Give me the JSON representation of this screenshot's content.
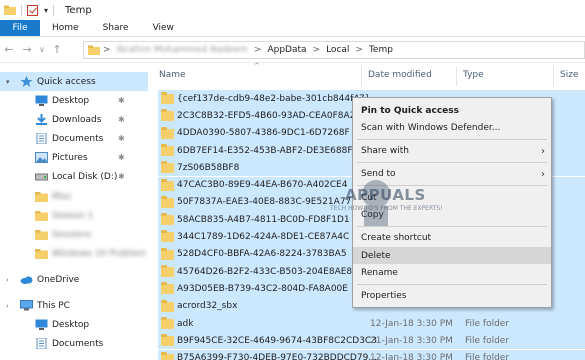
{
  "window": {
    "title": "Temp"
  },
  "ribbon": {
    "tabs": [
      "File",
      "Home",
      "Share",
      "View"
    ]
  },
  "address": {
    "crumbs": [
      "Ibrahim Mohammed Nadeem",
      "AppData",
      "Local",
      "Temp"
    ],
    "separator": ">"
  },
  "navpane": {
    "items": [
      {
        "label": "Quick access",
        "icon": "star-icon",
        "pinned": false,
        "selected": true,
        "blurred": false
      },
      {
        "label": "Desktop",
        "icon": "desktop-icon",
        "pinned": true,
        "selected": false,
        "blurred": false
      },
      {
        "label": "Downloads",
        "icon": "download-icon",
        "pinned": true,
        "selected": false,
        "blurred": false
      },
      {
        "label": "Documents",
        "icon": "documents-icon",
        "pinned": true,
        "selected": false,
        "blurred": false
      },
      {
        "label": "Pictures",
        "icon": "pictures-icon",
        "pinned": true,
        "selected": false,
        "blurred": false
      },
      {
        "label": "Local Disk (D:)",
        "icon": "drive-icon",
        "pinned": true,
        "selected": false,
        "blurred": false
      },
      {
        "label": "Misc",
        "icon": "folder-icon",
        "pinned": false,
        "selected": false,
        "blurred": true
      },
      {
        "label": "Season 1",
        "icon": "folder-icon",
        "pinned": false,
        "selected": false,
        "blurred": true
      },
      {
        "label": "Sessions",
        "icon": "folder-icon",
        "pinned": false,
        "selected": false,
        "blurred": true
      },
      {
        "label": "Windows 10 Problem",
        "icon": "folder-icon",
        "pinned": false,
        "selected": false,
        "blurred": true
      },
      {
        "label": "OneDrive",
        "icon": "cloud-icon",
        "pinned": false,
        "selected": false,
        "blurred": false
      },
      {
        "label": "This PC",
        "icon": "computer-icon",
        "pinned": false,
        "selected": false,
        "blurred": false
      },
      {
        "label": "Desktop",
        "icon": "desktop-icon",
        "pinned": false,
        "selected": false,
        "blurred": false
      },
      {
        "label": "Documents",
        "icon": "documents-icon",
        "pinned": false,
        "selected": false,
        "blurred": false
      }
    ]
  },
  "columns": {
    "name": "Name",
    "date": "Date modified",
    "type": "Type",
    "size": "Size"
  },
  "files": [
    {
      "name": "{cef137de-cdb9-48e2-babe-301cb844f47}",
      "date": "",
      "type": "",
      "selected": true
    },
    {
      "name": "2C3C8B32-EFD5-4B60-93AD-CEA0F8A2",
      "date": "",
      "type": "",
      "selected": true
    },
    {
      "name": "4DDA0390-5807-4386-9DC1-6D7268F",
      "date": "",
      "type": "",
      "selected": true
    },
    {
      "name": "6DB7EF14-E352-453B-ABF2-DE3E688F",
      "date": "",
      "type": "",
      "selected": true
    },
    {
      "name": "7zS06B58BF8",
      "date": "",
      "type": "",
      "selected": true
    },
    {
      "name": "47CAC3B0-89E9-44EA-B670-A402CE4",
      "date": "",
      "type": "",
      "selected": true
    },
    {
      "name": "50F7837A-EAE3-40E8-883C-9E521A77",
      "date": "",
      "type": "",
      "selected": true
    },
    {
      "name": "58ACB835-A4B7-4811-BC0D-FD8F1D1",
      "date": "",
      "type": "",
      "selected": true
    },
    {
      "name": "344C1789-1D62-424A-8DE1-CE87A4C",
      "date": "",
      "type": "",
      "selected": true
    },
    {
      "name": "528D4CF0-BBFA-42A6-8224-3783BA5",
      "date": "",
      "type": "",
      "selected": true
    },
    {
      "name": "45764D26-B2F2-433C-B503-204E8AE8",
      "date": "",
      "type": "",
      "selected": true
    },
    {
      "name": "A93D05EB-B739-43C2-804D-FA8A00E",
      "date": "",
      "type": "",
      "selected": true
    },
    {
      "name": "acrord32_sbx",
      "date": "",
      "type": "",
      "selected": true
    },
    {
      "name": "adk",
      "date": "12-Jan-18 3:30 PM",
      "type": "File folder",
      "selected": true
    },
    {
      "name": "B9F945CE-32CE-4649-9674-43BF8C2CD3C3",
      "date": "21-Jan-18 3:30 PM",
      "type": "File folder",
      "selected": true
    },
    {
      "name": "B75A6399-F730-4DEB-97E0-732BDDCD79...",
      "date": "12-Jan-18 3:30 PM",
      "type": "File folder",
      "selected": true
    }
  ],
  "context_menu": {
    "groups": [
      [
        {
          "label": "Pin to Quick access",
          "bold": true,
          "submenu": false,
          "hover": false
        },
        {
          "label": "Scan with Windows Defender...",
          "bold": false,
          "submenu": false,
          "hover": false
        }
      ],
      [
        {
          "label": "Share with",
          "bold": false,
          "submenu": true,
          "hover": false
        }
      ],
      [
        {
          "label": "Send to",
          "bold": false,
          "submenu": true,
          "hover": false
        }
      ],
      [
        {
          "label": "Cut",
          "bold": false,
          "submenu": false,
          "hover": false
        },
        {
          "label": "Copy",
          "bold": false,
          "submenu": false,
          "hover": false
        }
      ],
      [
        {
          "label": "Create shortcut",
          "bold": false,
          "submenu": false,
          "hover": false
        },
        {
          "label": "Delete",
          "bold": false,
          "submenu": false,
          "hover": true
        },
        {
          "label": "Rename",
          "bold": false,
          "submenu": false,
          "hover": false
        }
      ],
      [
        {
          "label": "Properties",
          "bold": false,
          "submenu": false,
          "hover": false
        }
      ]
    ]
  },
  "watermark": {
    "text": "APPUALS",
    "sub": "TECH HOW-TO'S FROM THE EXPERTS!"
  },
  "colors": {
    "accent": "#1979ca",
    "selection": "#cce8ff",
    "folder": "#f4cf6a"
  }
}
